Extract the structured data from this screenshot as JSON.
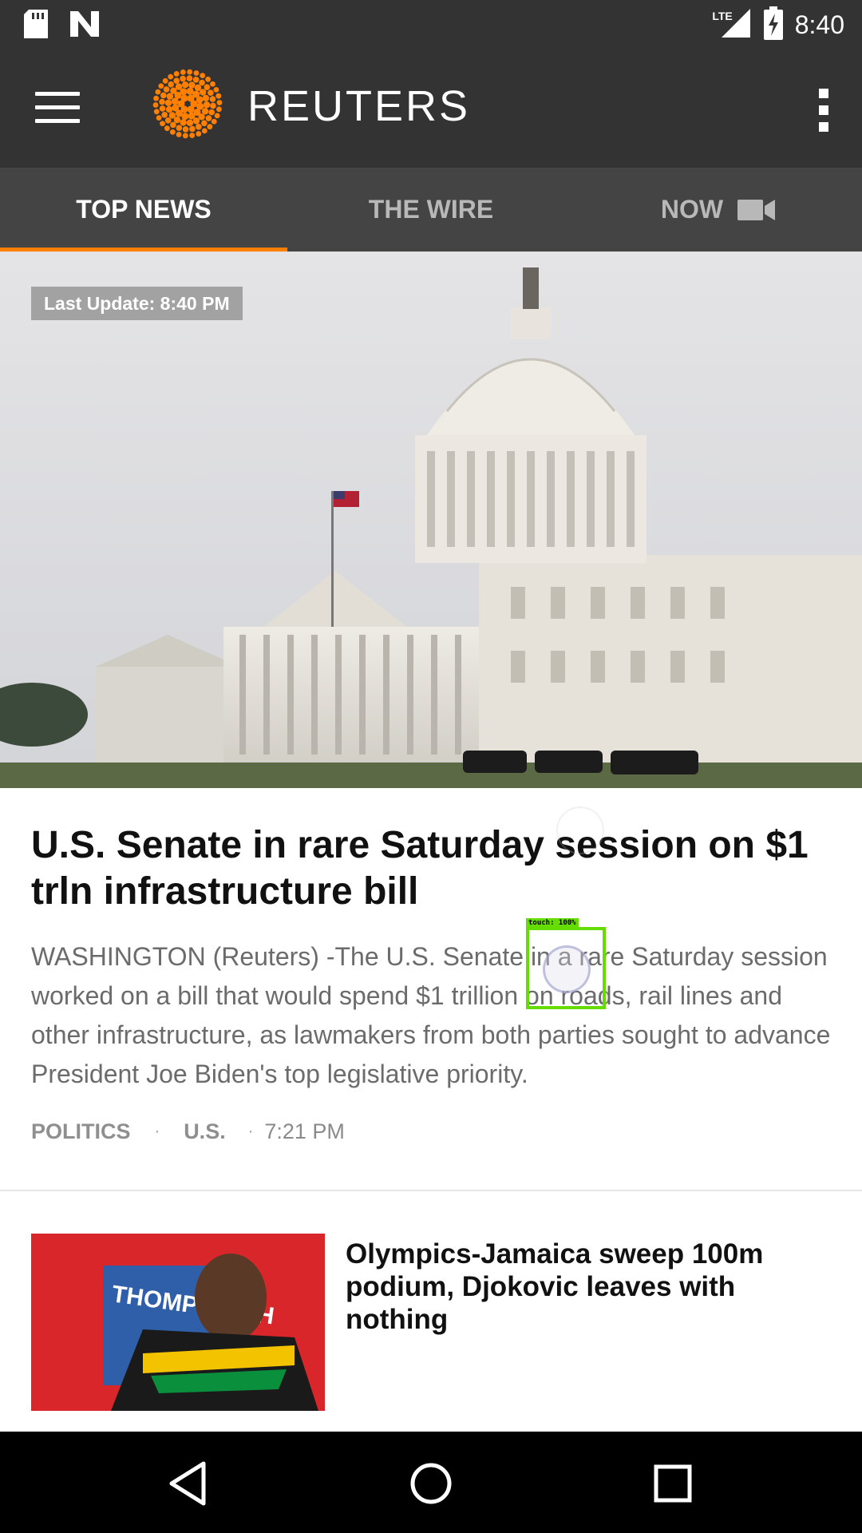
{
  "status_bar": {
    "network": "LTE",
    "time": "8:40",
    "icons": [
      "sd-card-icon",
      "n-notification-icon",
      "signal-icon",
      "battery-charging-icon"
    ]
  },
  "app_bar": {
    "brand": "REUTERS",
    "icons": [
      "hamburger-menu-icon",
      "reuters-logo-icon",
      "overflow-menu-icon"
    ]
  },
  "tabs": [
    {
      "label": "TOP NEWS",
      "active": true
    },
    {
      "label": "THE WIRE",
      "active": false
    },
    {
      "label": "NOW",
      "active": false,
      "icon": "video-camera-icon"
    }
  ],
  "hero": {
    "last_update": "Last Update: 8:40 PM",
    "image": "us-capitol-building-photo"
  },
  "lead_story": {
    "headline": "U.S. Senate in rare Saturday session on $1 trln infrastructure bill",
    "summary": "WASHINGTON (Reuters) -The U.S. Senate in a rare Saturday session worked on a bill that would spend $1 trillion on roads, rail lines and other infrastructure, as lawmakers from both parties sought to advance President Joe Biden's top legislative priority.",
    "tag1": "POLITICS",
    "tag2": "U.S.",
    "separator": "·",
    "time": "7:21 PM"
  },
  "story2": {
    "headline": "Olympics-Jamaica sweep 100m podium, Djokovic leaves with nothing",
    "thumb_text": "THOMPSON-H"
  },
  "touch_overlay": {
    "label": "touch: 100%"
  },
  "nav_bar": {
    "icons": [
      "back-icon",
      "home-icon",
      "recents-icon"
    ]
  },
  "colors": {
    "bar_bg": "#333333",
    "tab_bg": "#444444",
    "accent": "#ff8000"
  }
}
